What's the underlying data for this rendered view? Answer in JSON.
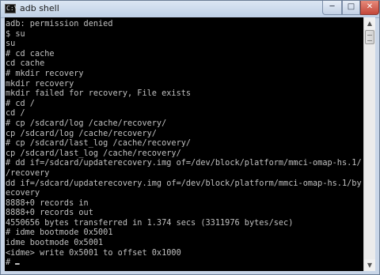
{
  "window": {
    "title": "adb  shell",
    "icon": "console-icon",
    "icon_glyph": "C:\\",
    "controls": {
      "minimize_glyph": "─",
      "maximize_glyph": "□",
      "close_glyph": "✕"
    }
  },
  "console": {
    "lines": [
      "adb: permission denied",
      "$ su",
      "su",
      "# cd cache",
      "cd cache",
      "# mkdir recovery",
      "mkdir recovery",
      "mkdir failed for recovery, File exists",
      "# cd /",
      "cd /",
      "# cp /sdcard/log /cache/recovery/",
      "cp /sdcard/log /cache/recovery/",
      "# cp /sdcard/last_log /cache/recovery/",
      "cp /sdcard/last_log /cache/recovery/",
      "# dd if=/sdcard/updaterecovery.img of=/dev/block/platform/mmci-omap-hs.1/by-name",
      "/recovery",
      "dd if=/sdcard/updaterecovery.img of=/dev/block/platform/mmci-omap-hs.1/by-name/r",
      "ecovery",
      "8888+0 records in",
      "8888+0 records out",
      "4550656 bytes transferred in 1.374 secs (3311976 bytes/sec)",
      "# idme bootmode 0x5001",
      "idme bootmode 0x5001",
      "<idme> write 0x5001 to offset 0x1000",
      "#"
    ]
  },
  "scrollbar": {
    "up_glyph": "▲",
    "down_glyph": "▼",
    "position_fraction": 0.0
  },
  "colors": {
    "console_background": "#000000",
    "console_text": "#c0c0c0",
    "close_button": "#c4473a"
  }
}
